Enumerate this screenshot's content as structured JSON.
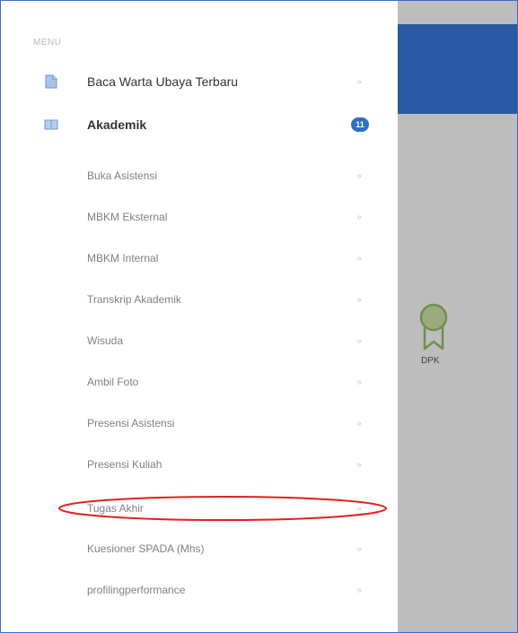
{
  "sidebar": {
    "menu_label": "MENU",
    "top_items": [
      {
        "label": "Baca Warta Ubaya Terbaru",
        "icon": "document-icon"
      },
      {
        "label": "Akademik",
        "icon": "book-icon",
        "badge": "11"
      }
    ],
    "sub_items": [
      {
        "label": "Buka Asistensi"
      },
      {
        "label": "MBKM Eksternal"
      },
      {
        "label": "MBKM Internal"
      },
      {
        "label": "Transkrip Akademik"
      },
      {
        "label": "Wisuda"
      },
      {
        "label": "Ambil Foto"
      },
      {
        "label": "Presensi Asistensi"
      },
      {
        "label": "Presensi Kuliah"
      },
      {
        "label": "Tugas Akhir"
      },
      {
        "label": "Kuesioner SPADA (Mhs)"
      },
      {
        "label": "profilingperformance"
      }
    ],
    "chevron_glyph": "»"
  },
  "main": {
    "award_label": "DPK",
    "award_icon": "award-ribbon-icon"
  },
  "colors": {
    "accent": "#2f6ec9",
    "header": "#2a5aa3",
    "award_green": "#6f8f4e",
    "highlight": "#e0201f"
  }
}
